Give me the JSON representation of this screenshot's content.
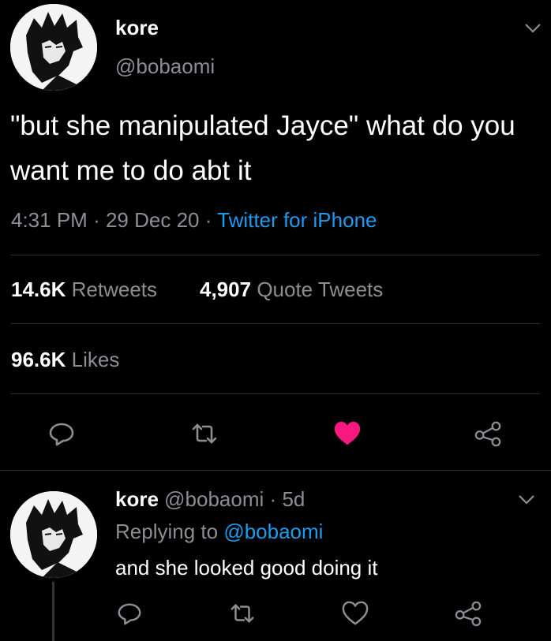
{
  "colors": {
    "accent": "#1d9bf0",
    "like": "#f91880",
    "background": "#000000"
  },
  "main_tweet": {
    "display_name": "kore",
    "handle": "@bobaomi",
    "text": "\"but she manipulated Jayce\" what do you want me to do abt it",
    "time": "4:31 PM",
    "sep1": "·",
    "date": "29 Dec 20",
    "sep2": "·",
    "source": "Twitter for iPhone",
    "retweets_count": "14.6K",
    "retweets_label": "Retweets",
    "quotes_count": "4,907",
    "quotes_label": "Quote Tweets",
    "likes_count": "96.6K",
    "likes_label": "Likes",
    "liked": true,
    "icons": [
      "reply-icon",
      "retweet-icon",
      "heart-filled-icon",
      "share-icon"
    ]
  },
  "reply_tweet": {
    "display_name": "kore",
    "handle": "@bobaomi",
    "sep": "·",
    "age": "5d",
    "replying_prefix": "Replying to",
    "replying_handle": "@bobaomi",
    "text": "and she looked good doing it",
    "liked": false,
    "icons": [
      "reply-icon",
      "retweet-icon",
      "heart-outline-icon",
      "share-icon"
    ]
  }
}
